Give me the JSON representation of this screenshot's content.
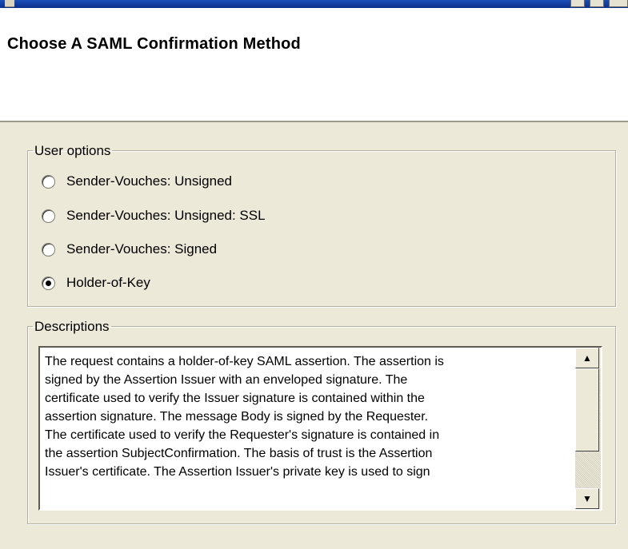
{
  "window": {
    "icon": "app-icon",
    "controls": [
      "minimize-icon",
      "maximize-icon",
      "close-icon"
    ]
  },
  "header": {
    "title": "Choose A SAML Confirmation Method"
  },
  "user_options": {
    "legend": "User options",
    "options": [
      {
        "label": "Sender-Vouches: Unsigned",
        "selected": false
      },
      {
        "label": "Sender-Vouches: Unsigned: SSL",
        "selected": false
      },
      {
        "label": "Sender-Vouches: Signed",
        "selected": false
      },
      {
        "label": "Holder-of-Key",
        "selected": true
      }
    ]
  },
  "descriptions": {
    "legend": "Descriptions",
    "text": "The request contains a holder-of-key SAML assertion. The assertion is\nsigned by the Assertion Issuer with an enveloped signature. The\ncertificate used to verify the Issuer signature is contained within the\nassertion signature. The message Body is signed by the Requester.\nThe certificate used to verify the Requester's signature is contained in\nthe assertion SubjectConfirmation. The basis of trust is the Assertion\nIssuer's certificate. The Assertion Issuer's private key is used to sign",
    "scroll_up_icon": "scroll-up-arrow-icon",
    "scroll_down_icon": "scroll-down-arrow-icon",
    "scroll_position": 0.0
  },
  "colors": {
    "dialog_bg": "#ece9d8",
    "header_bg": "#ffffff",
    "titlebar": "#0a2f8c"
  }
}
